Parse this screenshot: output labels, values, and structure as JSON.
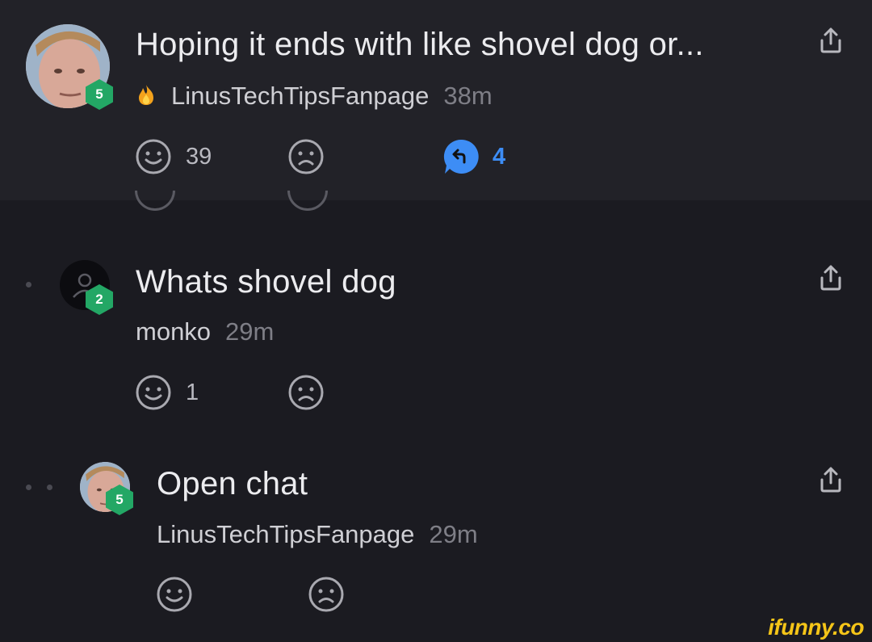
{
  "comments": [
    {
      "title": "Hoping it ends with like shovel dog or...",
      "author": "LinusTechTipsFanpage",
      "time": "38m",
      "level": "5",
      "likes": "39",
      "replies": "4",
      "avatar": "user-photo",
      "author_icon": "flame-icon"
    },
    {
      "title": "Whats shovel dog",
      "author": "monko",
      "time": "29m",
      "level": "2",
      "likes": "1",
      "avatar": "default-user-icon"
    },
    {
      "title": "Open chat",
      "author": "LinusTechTipsFanpage",
      "time": "29m",
      "level": "5",
      "likes": "",
      "avatar": "user-photo"
    }
  ],
  "colors": {
    "background": "#1b1b21",
    "highlight_band": "#222228",
    "badge": "#23a765",
    "reply_accent": "#3d8df5",
    "watermark": "#f5c518"
  },
  "watermark": "ifunny.co"
}
